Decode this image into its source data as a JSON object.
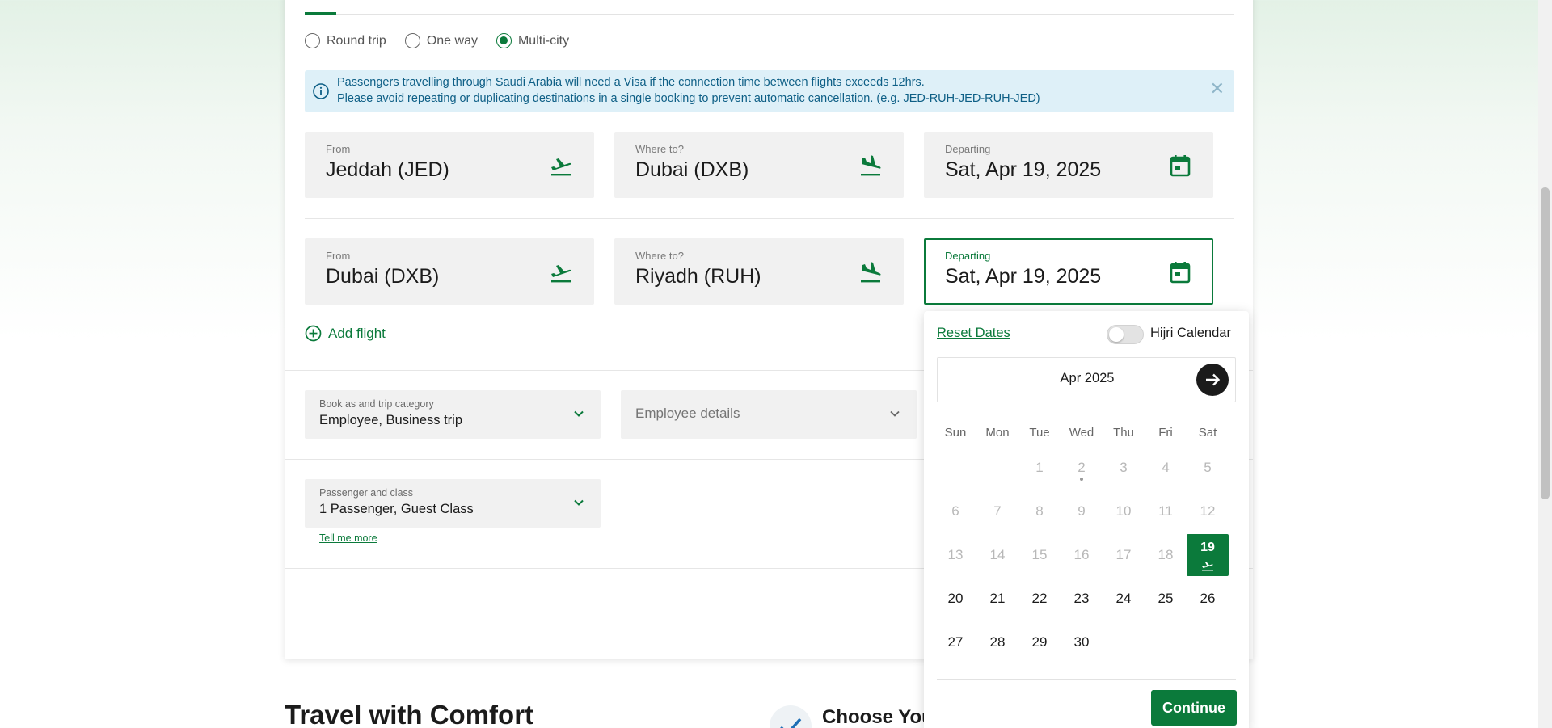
{
  "trip_types": [
    {
      "label": "Round trip",
      "selected": false
    },
    {
      "label": "One way",
      "selected": false
    },
    {
      "label": "Multi-city",
      "selected": true
    }
  ],
  "info": {
    "line1": "Passengers travelling through Saudi Arabia will need a Visa if the connection time between flights exceeds 12hrs.",
    "line2": "Please avoid repeating or duplicating destinations in a single booking to prevent automatic cancellation. (e.g. JED-RUH-JED-RUH-JED)",
    "close_icon": "close-icon"
  },
  "flights": [
    {
      "from_label": "From",
      "from_value": "Jeddah (JED)",
      "to_label": "Where to?",
      "to_value": "Dubai (DXB)",
      "date_label": "Departing",
      "date_value": "Sat, Apr 19, 2025"
    },
    {
      "from_label": "From",
      "from_value": "Dubai (DXB)",
      "to_label": "Where to?",
      "to_value": "Riyadh (RUH)",
      "date_label": "Departing",
      "date_value": "Sat, Apr 19, 2025"
    }
  ],
  "add_flight": "Add flight",
  "booking": {
    "category_label": "Book as and trip category",
    "category_value": "Employee, Business trip",
    "employee_placeholder": "Employee details",
    "passenger_label": "Passenger and class",
    "passenger_value": "1 Passenger, Guest Class",
    "tell_more": "Tell me more"
  },
  "calendar": {
    "reset": "Reset Dates",
    "hijri_label": "Hijri Calendar",
    "hijri_enabled": false,
    "month": "Apr 2025",
    "weekdays": [
      "Sun",
      "Mon",
      "Tue",
      "Wed",
      "Thu",
      "Fri",
      "Sat"
    ],
    "first_weekday_index": 2,
    "days_in_month": 30,
    "first_selectable_day": 19,
    "selected_day": 19,
    "today_day": 2,
    "continue": "Continue"
  },
  "sections": {
    "travel_heading": "Travel with Comfort",
    "choose_heading": "Choose You"
  },
  "colors": {
    "accent": "#0b7a3b",
    "info_bg": "#def0f8",
    "info_text": "#0e5f86"
  }
}
